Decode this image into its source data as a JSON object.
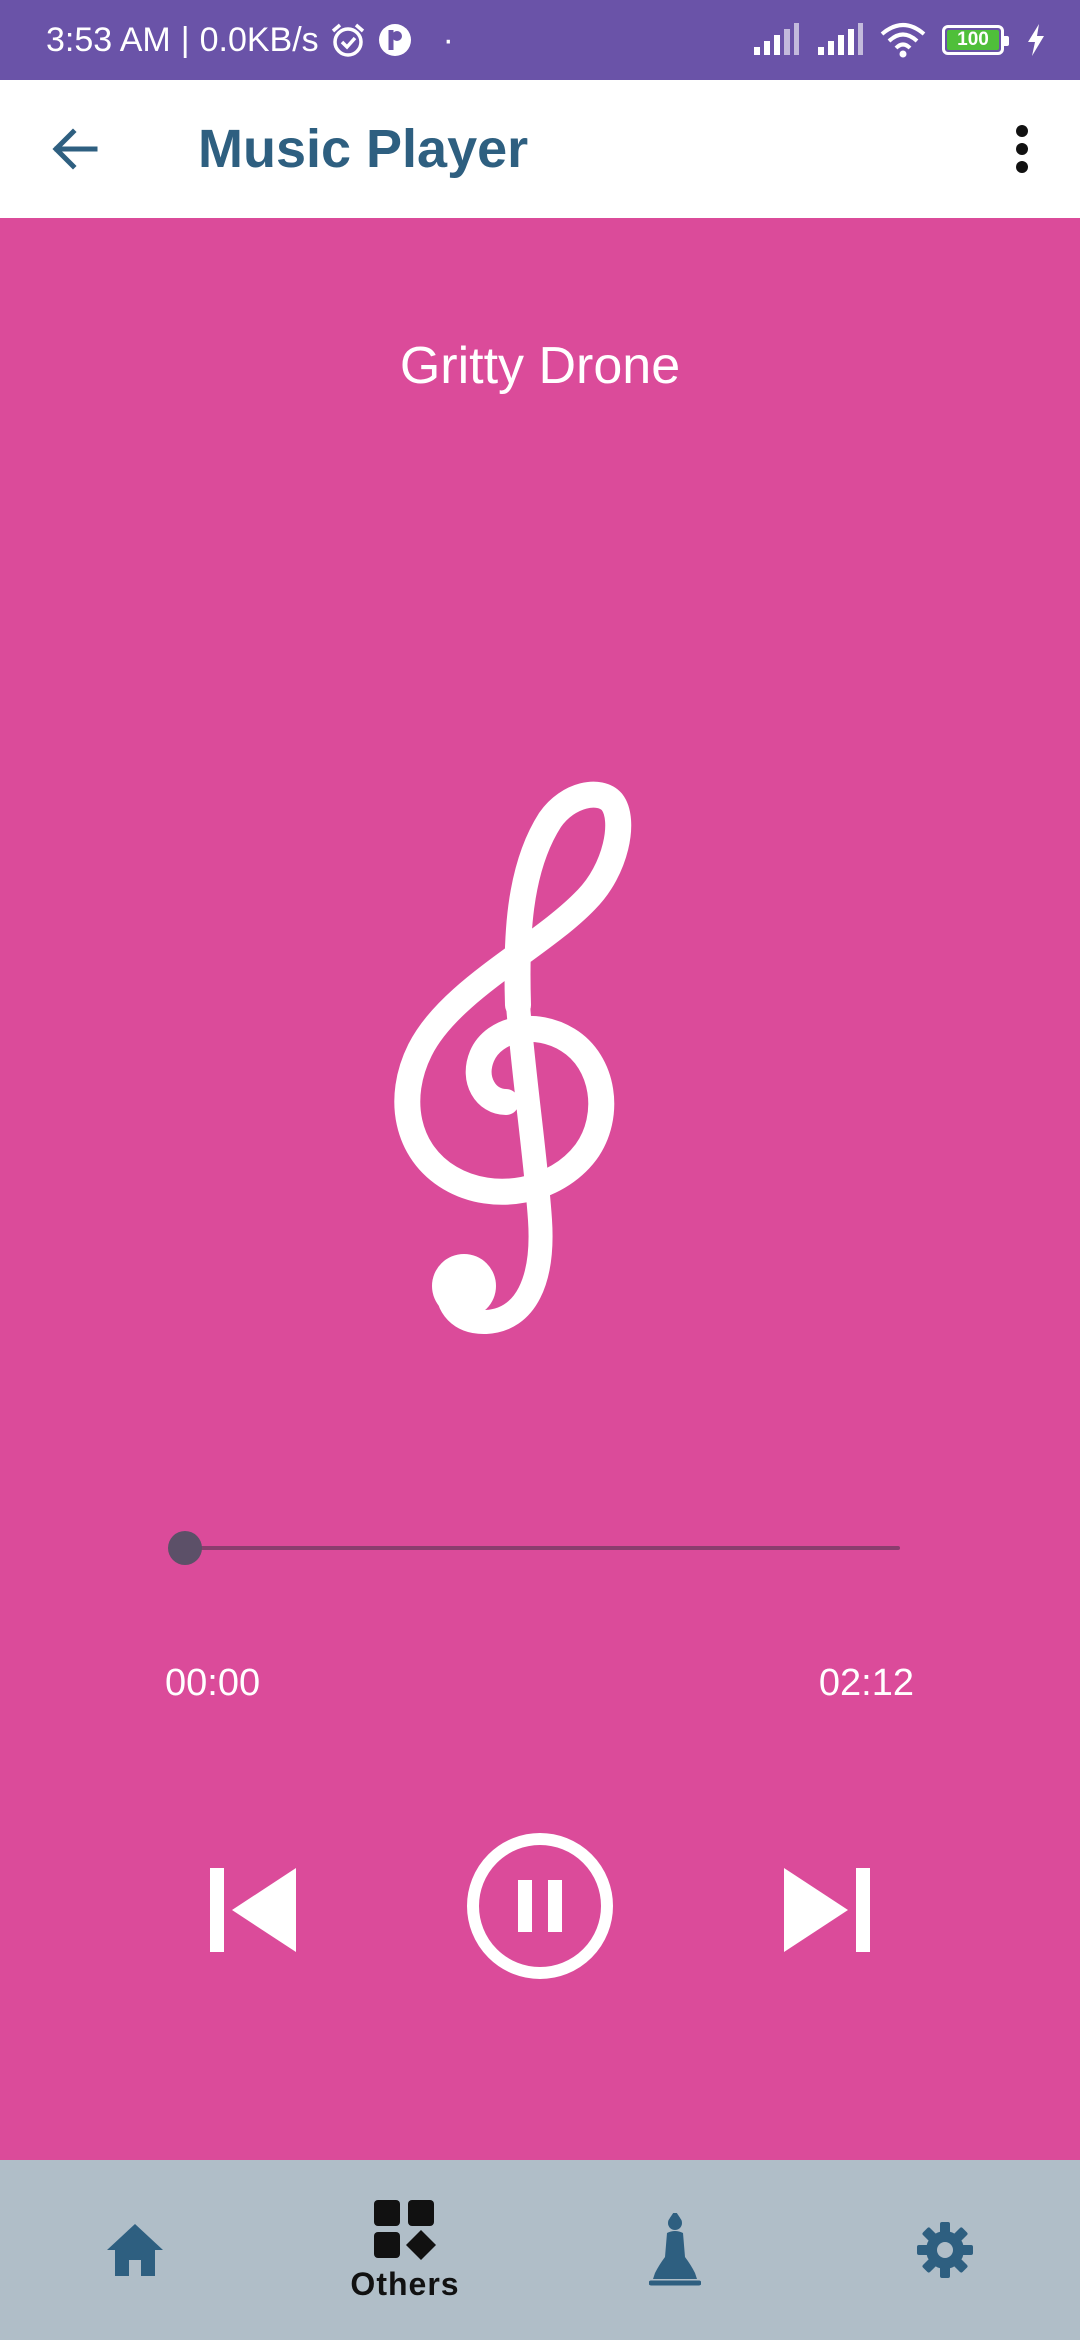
{
  "status_bar": {
    "time": "3:53 AM",
    "separator": "|",
    "network_speed": "0.0KB/s",
    "dot": "·",
    "battery_level": "100",
    "icons": [
      "alarm-icon",
      "app-notification-icon",
      "signal-icon",
      "signal-icon",
      "wifi-icon",
      "battery-icon",
      "charging-icon"
    ]
  },
  "app_bar": {
    "title": "Music Player",
    "icons": [
      "back-arrow-icon",
      "more-vert-icon"
    ]
  },
  "player": {
    "song_title": "Gritty Drone",
    "album_art_icon": "treble-clef-icon",
    "progress": 0,
    "current_time": "00:00",
    "total_time": "02:12",
    "controls": [
      "skip-previous-icon",
      "pause-icon",
      "skip-next-icon"
    ]
  },
  "bottom_nav": {
    "items": [
      {
        "icon": "home-icon",
        "label": ""
      },
      {
        "icon": "grid-icon",
        "label": "Others",
        "active": true
      },
      {
        "icon": "meditation-icon",
        "label": ""
      },
      {
        "icon": "gear-icon",
        "label": ""
      }
    ]
  },
  "colors": {
    "status_bar": "#6a53a8",
    "app_bar": "#ffffff",
    "title": "#2e5f80",
    "background": "#db4b9a",
    "bottom_nav": "#b0bec8",
    "nav_icon": "#2e5f80"
  }
}
